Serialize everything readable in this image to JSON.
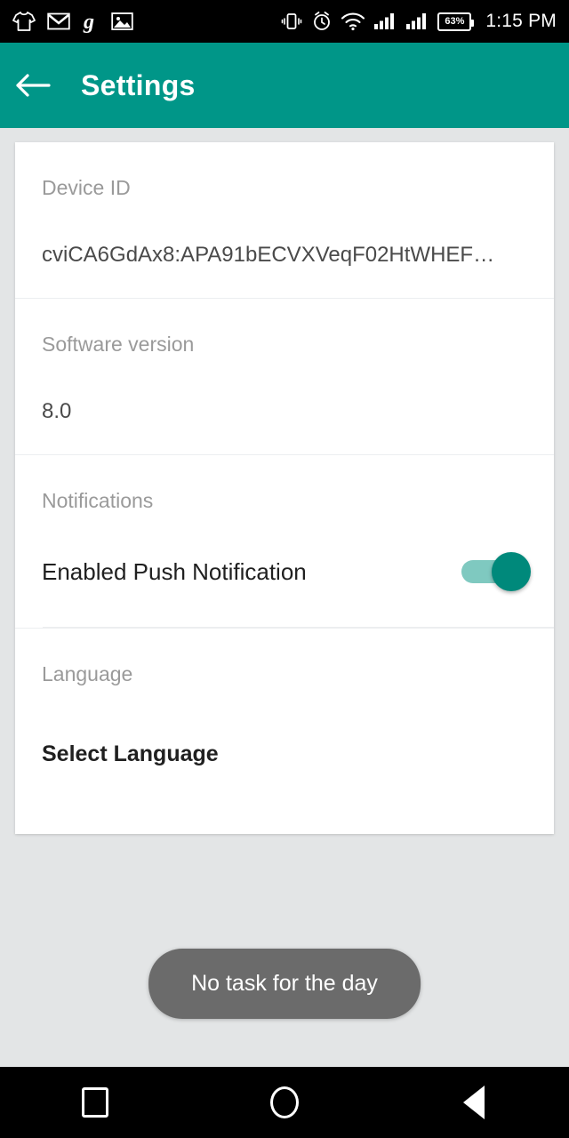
{
  "status_bar": {
    "left_icons": [
      "shirt-icon",
      "gmail-icon",
      "glide-g-icon",
      "photo-icon"
    ],
    "right_icons": [
      "vibrate-icon",
      "alarm-icon",
      "wifi-icon",
      "signal-sim1-icon",
      "signal-sim2-icon"
    ],
    "battery_percent": "63%",
    "time": "1:15 PM"
  },
  "app_bar": {
    "back_icon": "arrow-left-icon",
    "title": "Settings",
    "background_color": "#009688"
  },
  "settings": {
    "device_id": {
      "header": "Device ID",
      "value": "cviCA6GdAx8:APA91bECVXVeqF02HtWHEF…"
    },
    "software_version": {
      "header": "Software version",
      "value": "8.0"
    },
    "notifications": {
      "header": "Notifications",
      "item_label": "Enabled Push Notification",
      "toggle_state": "on",
      "toggle_track_color": "#7fc9c0",
      "toggle_thumb_color": "#00897b"
    },
    "language": {
      "header": "Language",
      "select_label": "Select Language"
    }
  },
  "toast": {
    "message": "No task for the day",
    "background_color": "#6b6b6b"
  },
  "nav_bar": {
    "recents_icon": "square-recents-icon",
    "home_icon": "circle-home-icon",
    "back_icon": "triangle-back-icon"
  }
}
